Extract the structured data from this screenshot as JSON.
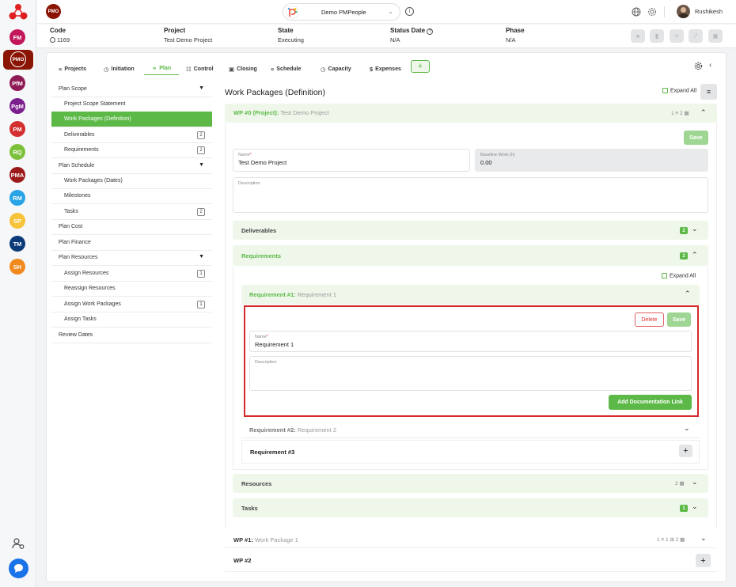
{
  "topbar": {
    "app_badge": "PMO",
    "project_selector": "Demo PMPeople",
    "user_name": "Rushikesh"
  },
  "rail": {
    "items": [
      {
        "label": "FM",
        "color": "#c2185b"
      },
      {
        "label": "PMO",
        "color": "#8a1505"
      },
      {
        "label": "PfM",
        "color": "#8e1b55"
      },
      {
        "label": "PgM",
        "color": "#7b1f8c"
      },
      {
        "label": "PM",
        "color": "#d32f2f"
      },
      {
        "label": "RQ",
        "color": "#7cc13b"
      },
      {
        "label": "PMA",
        "color": "#9c1a1a"
      },
      {
        "label": "RM",
        "color": "#29a4e6"
      },
      {
        "label": "SP",
        "color": "#f6c33a"
      },
      {
        "label": "TM",
        "color": "#0b3a78"
      },
      {
        "label": "SH",
        "color": "#f08a1e"
      }
    ]
  },
  "info": {
    "code_label": "Code",
    "code_value": "1169",
    "project_label": "Project",
    "project_value": "Test Demo Project",
    "state_label": "State",
    "state_value": "Executing",
    "status_label": "Status Date",
    "status_value": "N/A",
    "phase_label": "Phase",
    "phase_value": "N/A"
  },
  "tabs": [
    "Projects",
    "Initiation",
    "Plan",
    "Control",
    "Closing",
    "Schedule",
    "Capacity",
    "Expenses"
  ],
  "menu": {
    "plan_scope": "Plan Scope",
    "project_scope_statement": "Project Scope Statement",
    "work_packages_definition": "Work Packages (Definition)",
    "deliverables": "Deliverables",
    "deliverables_count": "2",
    "requirements": "Requirements",
    "requirements_count": "2",
    "plan_schedule": "Plan Schedule",
    "work_packages_dates": "Work Packages (Dates)",
    "milestones": "Milestones",
    "tasks": "Tasks",
    "tasks_count": "2",
    "plan_cost": "Plan Cost",
    "plan_finance": "Plan Finance",
    "plan_resources": "Plan Resources",
    "assign_resources": "Assign Resources",
    "assign_resources_count": "1",
    "reassign_resources": "Reassign Resources",
    "assign_work_packages": "Assign Work Packages",
    "assign_work_packages_count": "1",
    "assign_tasks": "Assign Tasks",
    "review_dates": "Review Dates"
  },
  "content": {
    "title": "Work Packages (Definition)",
    "expand_all": "Expand All",
    "wp0_id": "WP #0 (Project):",
    "wp0_name": "Test Demo Project",
    "wp0_counts": "1 ≡ 2",
    "save": "Save",
    "name_label": "Name",
    "name_value": "Test Demo Project",
    "baseline_label": "Baseline Work (h)",
    "baseline_value": "0.00",
    "description_label": "Description",
    "deliverables": "Deliverables",
    "deliverables_count": "2",
    "requirements": "Requirements",
    "requirements_count": "2",
    "req_expand_all": "Expand All",
    "req1_id": "Requirement #1:",
    "req1_name": "Requirement 1",
    "delete": "Delete",
    "req1_save": "Save",
    "req_name_label": "Name",
    "req_name_value": "Requirement 1",
    "req_desc_label": "Description",
    "add_doc_link": "Add Documentation Link",
    "req2_id": "Requirement #2:",
    "req2_name": "Requirement 2",
    "req3_id": "Requirement #3",
    "resources": "Resources",
    "resources_count": "2",
    "tasks": "Tasks",
    "tasks_count": "1",
    "wp1_id": "WP #1:",
    "wp1_name": "Work Package 1",
    "wp1_counts": "1 ≡ 1 ⊞ 2",
    "wp2_id": "WP #2"
  },
  "colors": {
    "accent": "#5cb947",
    "highlight_border": "#d42a2a"
  }
}
